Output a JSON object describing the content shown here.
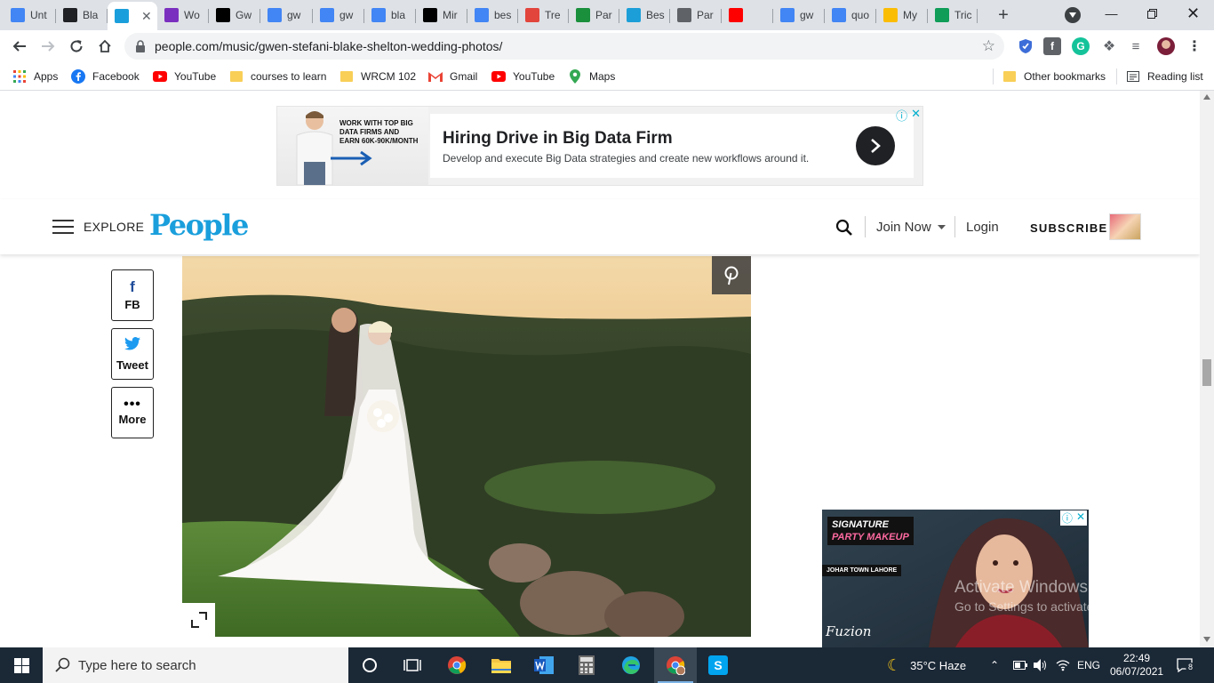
{
  "tabs": [
    {
      "label": "Unt",
      "icon": "google-docs-icon",
      "color": "#4285f4"
    },
    {
      "label": "Bla",
      "icon": "people-tab-icon",
      "color": "#202124"
    },
    {
      "label": "",
      "icon": "p-tab-icon",
      "color": "#1a9fdc",
      "active": true
    },
    {
      "label": "Wo",
      "icon": "wattpad-icon",
      "color": "#7b2fbf"
    },
    {
      "label": "Gw",
      "icon": "b-icon",
      "color": "#000000"
    },
    {
      "label": "gw",
      "icon": "google-icon",
      "color": "#4285f4"
    },
    {
      "label": "gw",
      "icon": "google-icon",
      "color": "#4285f4"
    },
    {
      "label": "bla",
      "icon": "google-icon",
      "color": "#4285f4"
    },
    {
      "label": "Mir",
      "icon": "l-icon",
      "color": "#000000"
    },
    {
      "label": "bes",
      "icon": "google-icon",
      "color": "#4285f4"
    },
    {
      "label": "Tre",
      "icon": "trello-icon",
      "color": "#e2453c"
    },
    {
      "label": "Par",
      "icon": "r-icon",
      "color": "#1a8f3c"
    },
    {
      "label": "Bes",
      "icon": "seo-icon",
      "color": "#1c9fd8"
    },
    {
      "label": "Par",
      "icon": "quill-icon",
      "color": "#5f6368"
    },
    {
      "label": "",
      "icon": "youtube-icon",
      "color": "#ff0000"
    },
    {
      "label": "gw",
      "icon": "google-icon",
      "color": "#4285f4"
    },
    {
      "label": "quo",
      "icon": "google-icon",
      "color": "#4285f4"
    },
    {
      "label": "My",
      "icon": "drive-icon",
      "color": "#fbbc04"
    },
    {
      "label": "Tric",
      "icon": "sheets-plus-icon",
      "color": "#0f9d58"
    }
  ],
  "toolbar": {
    "url": "people.com/music/gwen-stefani-blake-shelton-wedding-photos/"
  },
  "bookmarks": {
    "items": [
      {
        "label": "Apps",
        "icon": "apps-grid-icon"
      },
      {
        "label": "Facebook",
        "icon": "facebook-icon"
      },
      {
        "label": "YouTube",
        "icon": "youtube-icon"
      },
      {
        "label": "courses to learn",
        "icon": "folder-icon"
      },
      {
        "label": "WRCM 102",
        "icon": "folder-icon"
      },
      {
        "label": "Gmail",
        "icon": "gmail-icon"
      },
      {
        "label": "YouTube",
        "icon": "youtube-icon"
      },
      {
        "label": "Maps",
        "icon": "maps-pin-icon"
      }
    ],
    "other": "Other bookmarks",
    "reading_list": "Reading list"
  },
  "top_ad": {
    "image_text": "WORK WITH TOP BIG DATA FIRMS AND EARN 60K-90K/MONTH",
    "title": "Hiring Drive in Big Data Firm",
    "subtitle": "Develop and execute Big Data strategies and create new workflows around it."
  },
  "header": {
    "explore": "EXPLORE",
    "logo": "People",
    "join": "Join Now",
    "login": "Login",
    "subscribe": "SUBSCRIBE"
  },
  "share": {
    "fb": "FB",
    "tweet": "Tweet",
    "more": "More"
  },
  "side_ad": {
    "tag_line1": "SIGNATURE",
    "tag_line2": "PARTY MAKEUP",
    "location": "JOHAR TOWN LAHORE",
    "brand": "Fuzion"
  },
  "watermark": {
    "title": "Activate Windows",
    "subtitle": "Go to Settings to activate Windows."
  },
  "taskbar": {
    "search_placeholder": "Type here to search",
    "weather": "35°C  Haze",
    "language": "ENG",
    "time": "22:49",
    "date": "06/07/2021",
    "notifications": "8"
  },
  "colors": {
    "brand": "#1a9fdc",
    "taskbar": "#1b2836",
    "omnibox": "#f1f3f4"
  }
}
